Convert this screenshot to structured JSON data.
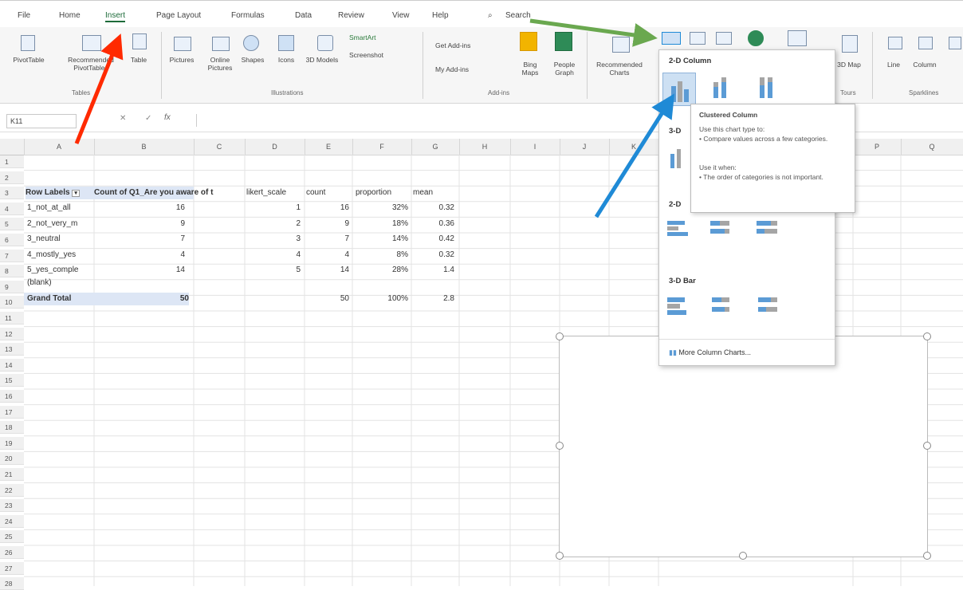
{
  "tabs": [
    "File",
    "Home",
    "Insert",
    "Page Layout",
    "Formulas",
    "Data",
    "Review",
    "View",
    "Help"
  ],
  "search_label": "Search",
  "ribbon": {
    "tables": {
      "pivottable": "PivotTable",
      "recommended_pivot": "Recommended PivotTables",
      "table": "Table",
      "group": "Tables"
    },
    "illustrations": {
      "pictures": "Pictures",
      "online_pictures": "Online Pictures",
      "shapes": "Shapes",
      "icons": "Icons",
      "models": "3D Models",
      "smartart": "SmartArt",
      "screenshot": "Screenshot",
      "group": "Illustrations"
    },
    "addins": {
      "get": "Get Add-ins",
      "my": "My Add-ins",
      "bing": "Bing Maps",
      "people": "People Graph",
      "group": "Add-ins"
    },
    "charts": {
      "recommended": "Recommended Charts",
      "map3d": "3D Map",
      "tours": "Tours"
    },
    "sparklines": {
      "line": "Line",
      "column": "Column",
      "group": "Sparklines"
    }
  },
  "formula_bar": {
    "name_box": "K11",
    "fx": "fx"
  },
  "columns": [
    "A",
    "B",
    "C",
    "D",
    "E",
    "F",
    "G",
    "H",
    "I",
    "J",
    "K",
    "",
    "",
    "",
    "",
    "P",
    "Q"
  ],
  "rows": [
    "1",
    "2",
    "3",
    "4",
    "5",
    "6",
    "7",
    "8",
    "9",
    "10",
    "11",
    "12",
    "13",
    "14",
    "15",
    "16",
    "17",
    "18",
    "19",
    "20",
    "21",
    "22",
    "23",
    "24",
    "25",
    "26",
    "27",
    "28"
  ],
  "sheet": {
    "header": {
      "row_labels": "Row Labels",
      "count_q1": "Count of Q1_Are you aware of t",
      "likert": "likert_scale",
      "count": "count",
      "proportion": "proportion",
      "mean": "mean"
    },
    "data": [
      {
        "label": "1_not_at_all",
        "countq": "16",
        "likert": "1",
        "count": "16",
        "prop": "32%",
        "mean": "0.32"
      },
      {
        "label": "2_not_very_m",
        "countq": "9",
        "likert": "2",
        "count": "9",
        "prop": "18%",
        "mean": "0.36"
      },
      {
        "label": "3_neutral",
        "countq": "7",
        "likert": "3",
        "count": "7",
        "prop": "14%",
        "mean": "0.42"
      },
      {
        "label": "4_mostly_yes",
        "countq": "4",
        "likert": "4",
        "count": "4",
        "prop": "8%",
        "mean": "0.32"
      },
      {
        "label": "5_yes_comple",
        "countq": "14",
        "likert": "5",
        "count": "14",
        "prop": "28%",
        "mean": "1.4"
      }
    ],
    "blank": "(blank)",
    "total": {
      "label": "Grand Total",
      "countq": "50",
      "count": "50",
      "prop": "100%",
      "mean": "2.8"
    }
  },
  "dropdown": {
    "sec_2d_column": "2-D Column",
    "sec_3d_column": "3-D",
    "sec_2d_bar": "2-D",
    "sec_3d_bar": "3-D Bar",
    "more": "More Column Charts..."
  },
  "tooltip": {
    "title": "Clustered Column",
    "line1": "Use this chart type to:",
    "line2": "• Compare values across a few categories.",
    "line3": "Use it when:",
    "line4": "• The order of categories is not important."
  },
  "colors": {
    "excel_green": "#1d6b3a",
    "red_arrow": "#ff2a00",
    "green_arrow": "#6aa84f",
    "blue_arrow": "#1f8ad6",
    "pivot_hl": "#dde6f5"
  }
}
